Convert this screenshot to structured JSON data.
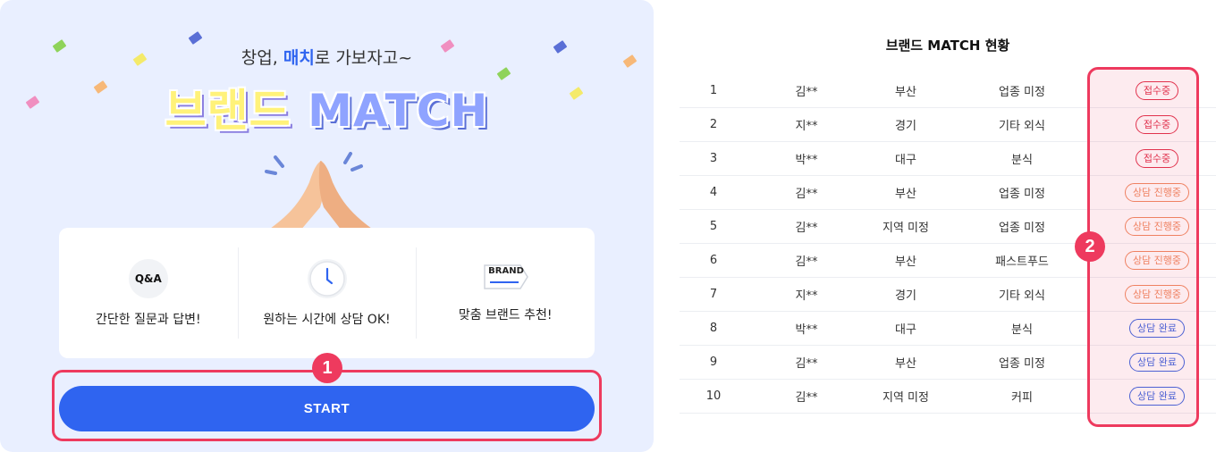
{
  "hero": {
    "tagline_prefix": "창업, ",
    "tagline_highlight": "매치",
    "tagline_suffix": "로 가보자고~",
    "title_brand": "브랜드",
    "title_match": "MATCH"
  },
  "features": [
    {
      "icon": "qa-bubble-icon",
      "icon_text": "Q&A",
      "label": "간단한 질문과 답변!"
    },
    {
      "icon": "clock-icon",
      "label": "원하는 시간에 상담 OK!"
    },
    {
      "icon": "brand-tag-icon",
      "icon_text": "BRAND",
      "label": "맞춤 브랜드 추천!"
    }
  ],
  "start_label": "START",
  "steps": {
    "one": "1",
    "two": "2"
  },
  "status": {
    "title": "브랜드 MATCH 현황",
    "rows": [
      {
        "no": "1",
        "name": "김**",
        "region": "부산",
        "industry": "업종 미정",
        "status": "접수중",
        "kind": "receiving"
      },
      {
        "no": "2",
        "name": "지**",
        "region": "경기",
        "industry": "기타 외식",
        "status": "접수중",
        "kind": "receiving"
      },
      {
        "no": "3",
        "name": "박**",
        "region": "대구",
        "industry": "분식",
        "status": "접수중",
        "kind": "receiving"
      },
      {
        "no": "4",
        "name": "김**",
        "region": "부산",
        "industry": "업종 미정",
        "status": "상담 진행중",
        "kind": "consulting"
      },
      {
        "no": "5",
        "name": "김**",
        "region": "지역 미정",
        "industry": "업종 미정",
        "status": "상담 진행중",
        "kind": "consulting"
      },
      {
        "no": "6",
        "name": "김**",
        "region": "부산",
        "industry": "패스트푸드",
        "status": "상담 진행중",
        "kind": "consulting"
      },
      {
        "no": "7",
        "name": "지**",
        "region": "경기",
        "industry": "기타 외식",
        "status": "상담 진행중",
        "kind": "consulting"
      },
      {
        "no": "8",
        "name": "박**",
        "region": "대구",
        "industry": "분식",
        "status": "상담 완료",
        "kind": "done"
      },
      {
        "no": "9",
        "name": "김**",
        "region": "부산",
        "industry": "업종 미정",
        "status": "상담 완료",
        "kind": "done"
      },
      {
        "no": "10",
        "name": "김**",
        "region": "지역 미정",
        "industry": "커피",
        "status": "상담 완료",
        "kind": "done"
      }
    ]
  },
  "colors": {
    "primary": "#2f64f0",
    "highlight": "#ee3a5e",
    "panel_bg": "#e9efff",
    "receiving": "#e0314b",
    "consulting": "#f08a62",
    "done": "#3b66e0"
  }
}
